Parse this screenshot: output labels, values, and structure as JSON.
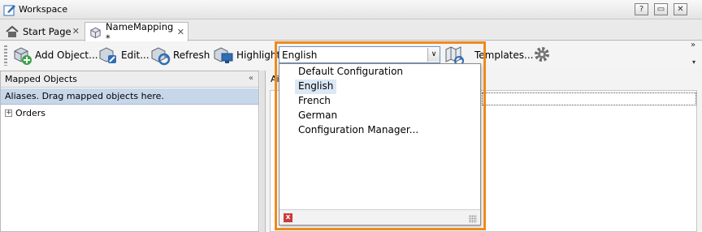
{
  "window": {
    "title": "Workspace",
    "buttons": {
      "help": "?",
      "minimize": "▭",
      "close": "✕"
    }
  },
  "tabs": [
    {
      "label": "Start Page",
      "close": "✕",
      "icon": "home-icon"
    },
    {
      "label": "NameMapping *",
      "close": "✕",
      "icon": "namemapping-icon",
      "active": true
    }
  ],
  "tab_menu": "∨",
  "toolbar": {
    "add_object": "Add Object...",
    "edit": "Edit...",
    "refresh": "Refresh",
    "highlight": "Highlight",
    "templates": "Templates...",
    "overflow": "»",
    "overflow_arrow": "▾"
  },
  "config_combo": {
    "value": "English",
    "arrow": "∨"
  },
  "dropdown": {
    "items": [
      {
        "label": "Default Configuration",
        "selected": false
      },
      {
        "label": "English",
        "selected": true
      },
      {
        "label": "French",
        "selected": false
      },
      {
        "label": "German",
        "selected": false
      },
      {
        "label": "Configuration Manager...",
        "selected": false
      }
    ],
    "close_label": "x"
  },
  "left_panel": {
    "title": "Mapped Objects",
    "collapse": "«",
    "hint": "Aliases. Drag mapped objects here.",
    "tree": [
      {
        "label": "Orders",
        "expander": "+"
      }
    ]
  },
  "right_panel": {
    "header": "Ai"
  },
  "colors": {
    "highlight_frame": "#f0891d",
    "selected_item": "#dce8f6",
    "hint_bar": "#c7d7ea"
  }
}
